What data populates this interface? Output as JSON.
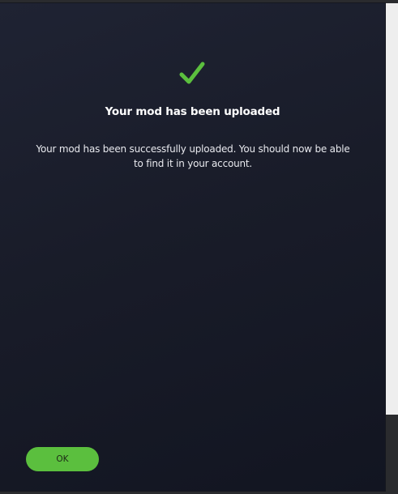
{
  "dialog": {
    "icon": "checkmark-icon",
    "title": "Your mod has been uploaded",
    "message": "Your mod has been successfully uploaded. You should now be able to find it in your account.",
    "ok_label": "OK"
  },
  "colors": {
    "accent": "#5bbf3e",
    "background": "#1a1d2a",
    "text": "#ffffff"
  }
}
